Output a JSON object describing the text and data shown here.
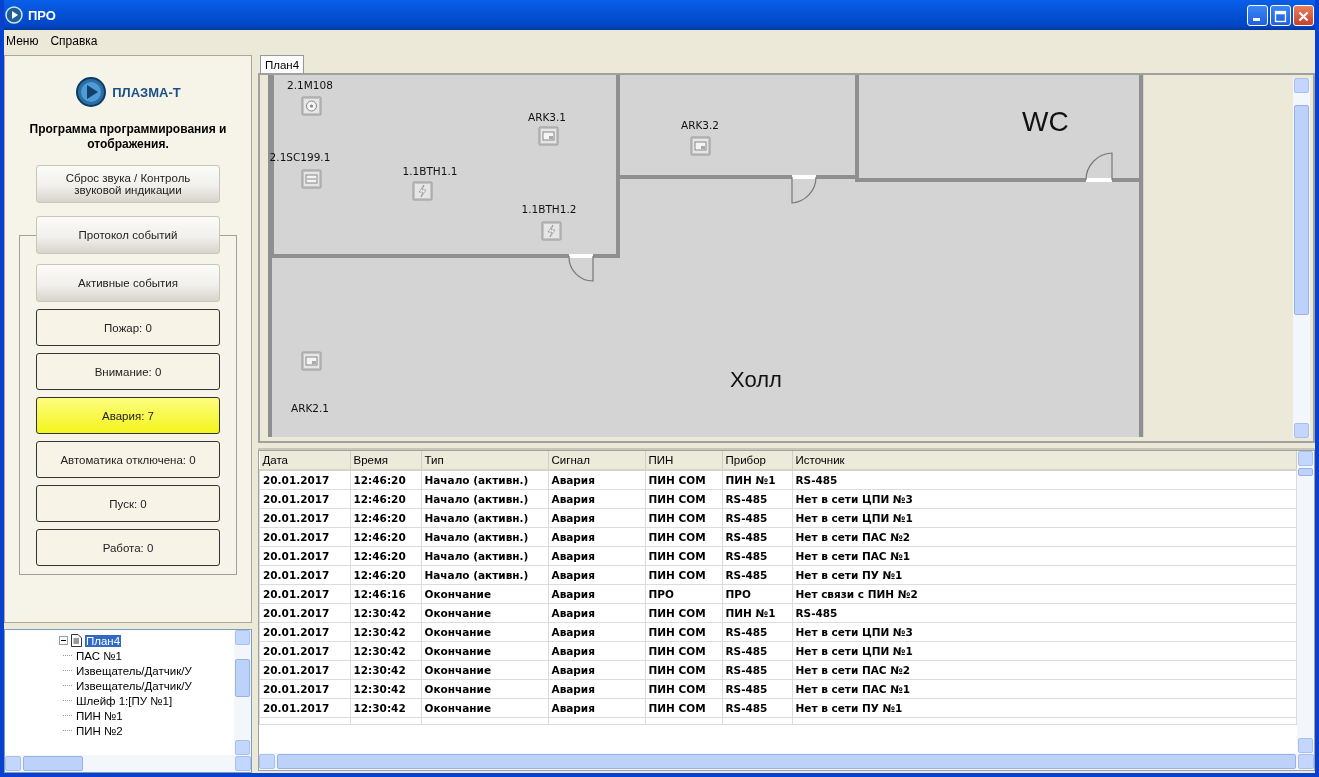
{
  "window": {
    "title": "ПРО"
  },
  "menu": [
    {
      "label": "Меню"
    },
    {
      "label": "Справка"
    }
  ],
  "sidebar": {
    "logo": "ПЛАЗМА-Т",
    "subtitle": "Программа программирования и отображения.",
    "buttons": [
      {
        "label": "Сброс звука / Контроль звуковой индикации"
      },
      {
        "label": "Протокол событий"
      }
    ],
    "group_button": {
      "label": "Активные события"
    },
    "counters": [
      {
        "label": "Пожар: 0",
        "active": false
      },
      {
        "label": "Внимание: 0",
        "active": false
      },
      {
        "label": "Авария: 7",
        "active": true
      },
      {
        "label": "Автоматика отключена: 0",
        "active": false
      },
      {
        "label": "Пуск: 0",
        "active": false
      },
      {
        "label": "Работа: 0",
        "active": false
      }
    ]
  },
  "tree": {
    "label": "План4",
    "selected": true,
    "expanded": true,
    "children": [
      {
        "label": "ПАС №1"
      },
      {
        "label": "Извещатель/Датчик/У"
      },
      {
        "label": "Извещатель/Датчик/У"
      },
      {
        "label": "Шлейф 1:[ПУ №1]"
      },
      {
        "label": "ПИН №1"
      },
      {
        "label": "ПИН №2"
      }
    ]
  },
  "plan": {
    "tabs": [
      {
        "label": "План4",
        "selected": true
      }
    ],
    "rooms": [
      {
        "label": "Холл"
      },
      {
        "label": "WC"
      }
    ],
    "devices": [
      {
        "label": "2.1M108",
        "kind": "detector"
      },
      {
        "label": "2.1SC199.1",
        "kind": "module"
      },
      {
        "label": "1.1BTH1.1",
        "kind": "sensor"
      },
      {
        "label": "ARK3.1",
        "kind": "panel"
      },
      {
        "label": "1.1BTH1.2",
        "kind": "sensor"
      },
      {
        "label": "ARK3.2",
        "kind": "panel"
      },
      {
        "label": "ARK2.1",
        "kind": "panel"
      }
    ]
  },
  "events": {
    "columns": [
      "Дата",
      "Время",
      "Тип",
      "Сигнал",
      "ПИН",
      "Прибор",
      "Источник"
    ],
    "rows": [
      [
        "20.01.2017",
        "12:46:20",
        "Начало (активн.)",
        "Авария",
        "ПИН COM",
        "ПИН №1",
        "RS-485"
      ],
      [
        "20.01.2017",
        "12:46:20",
        "Начало (активн.)",
        "Авария",
        "ПИН COM",
        "RS-485",
        "Нет в сети ЦПИ №3"
      ],
      [
        "20.01.2017",
        "12:46:20",
        "Начало (активн.)",
        "Авария",
        "ПИН COM",
        "RS-485",
        "Нет в сети ЦПИ №1"
      ],
      [
        "20.01.2017",
        "12:46:20",
        "Начало (активн.)",
        "Авария",
        "ПИН COM",
        "RS-485",
        "Нет в сети ПАС №2"
      ],
      [
        "20.01.2017",
        "12:46:20",
        "Начало (активн.)",
        "Авария",
        "ПИН COM",
        "RS-485",
        "Нет в сети ПАС №1"
      ],
      [
        "20.01.2017",
        "12:46:20",
        "Начало (активн.)",
        "Авария",
        "ПИН COM",
        "RS-485",
        "Нет в сети ПУ №1"
      ],
      [
        "20.01.2017",
        "12:46:16",
        "Окончание",
        "Авария",
        "ПРО",
        "ПРО",
        "Нет связи с ПИН №2"
      ],
      [
        "20.01.2017",
        "12:30:42",
        "Окончание",
        "Авария",
        "ПИН COM",
        "ПИН №1",
        "RS-485"
      ],
      [
        "20.01.2017",
        "12:30:42",
        "Окончание",
        "Авария",
        "ПИН COM",
        "RS-485",
        "Нет в сети ЦПИ №3"
      ],
      [
        "20.01.2017",
        "12:30:42",
        "Окончание",
        "Авария",
        "ПИН COM",
        "RS-485",
        "Нет в сети ЦПИ №1"
      ],
      [
        "20.01.2017",
        "12:30:42",
        "Окончание",
        "Авария",
        "ПИН COM",
        "RS-485",
        "Нет в сети ПАС №2"
      ],
      [
        "20.01.2017",
        "12:30:42",
        "Окончание",
        "Авария",
        "ПИН COM",
        "RS-485",
        "Нет в сети ПАС №1"
      ],
      [
        "20.01.2017",
        "12:30:42",
        "Окончание",
        "Авария",
        "ПИН COM",
        "RS-485",
        "Нет в сети ПУ №1"
      ]
    ]
  }
}
